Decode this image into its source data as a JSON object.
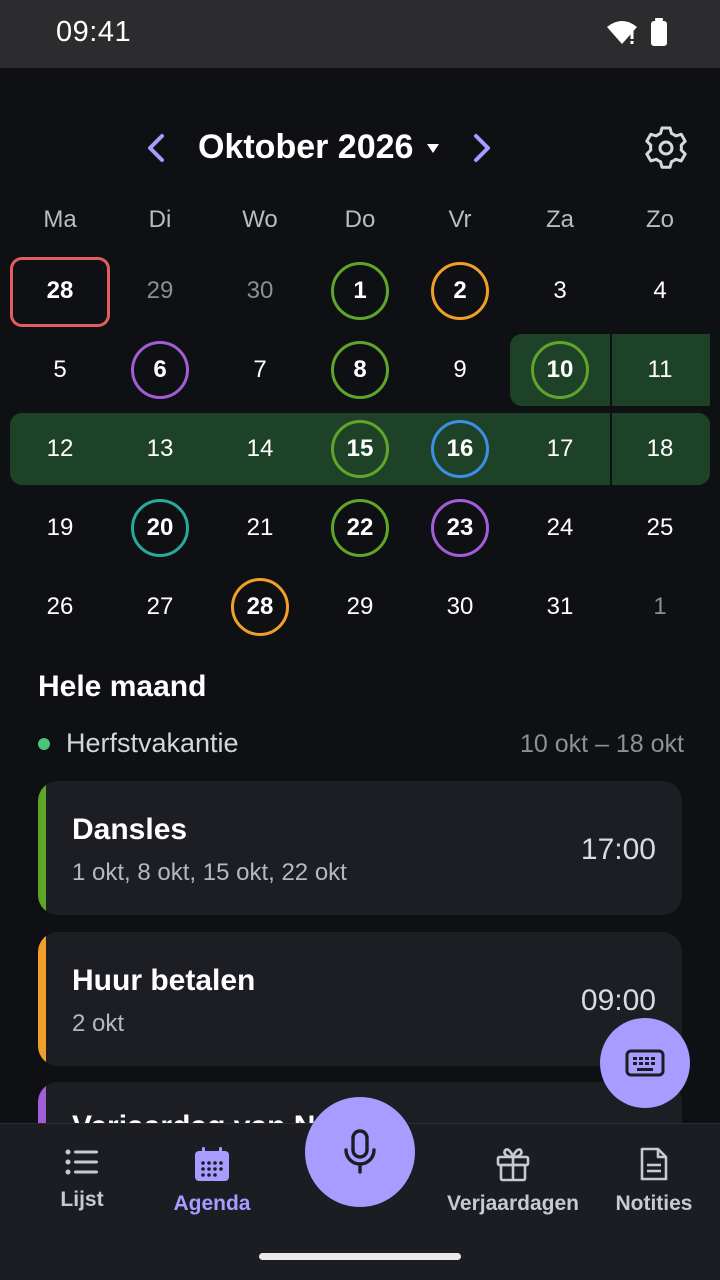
{
  "status": {
    "time": "09:41"
  },
  "header": {
    "title": "Oktober 2026"
  },
  "weekdays": [
    "Ma",
    "Di",
    "Wo",
    "Do",
    "Vr",
    "Za",
    "Zo"
  ],
  "calendar": {
    "r0": [
      "28",
      "29",
      "30",
      "1",
      "2",
      "3",
      "4"
    ],
    "r1": [
      "5",
      "6",
      "7",
      "8",
      "9",
      "10",
      "11"
    ],
    "r2": [
      "12",
      "13",
      "14",
      "15",
      "16",
      "17",
      "18"
    ],
    "r3": [
      "19",
      "20",
      "21",
      "22",
      "23",
      "24",
      "25"
    ],
    "r4": [
      "26",
      "27",
      "28",
      "29",
      "30",
      "31",
      "1"
    ]
  },
  "colors": {
    "accent": "#a99bff",
    "today": "#e25d5d",
    "green": "#5fa52a",
    "orange": "#f0a02a",
    "purple": "#a35dd8",
    "blue": "#3d8ee6",
    "teal": "#27a99b",
    "band": "#1e4227"
  },
  "section": {
    "title": "Hele maand"
  },
  "period": {
    "name": "Herfstvakantie",
    "range": "10 okt – 18 okt"
  },
  "events": [
    {
      "title": "Dansles",
      "dates": "1 okt, 8 okt, 15 okt, 22 okt",
      "time": "17:00"
    },
    {
      "title": "Huur betalen",
      "dates": "2 okt",
      "time": "09:00"
    },
    {
      "title": "Verjaardag van N"
    }
  ],
  "nav": {
    "lijst": "Lijst",
    "agenda": "Agenda",
    "verjaardagen": "Verjaardagen",
    "notities": "Notities"
  }
}
